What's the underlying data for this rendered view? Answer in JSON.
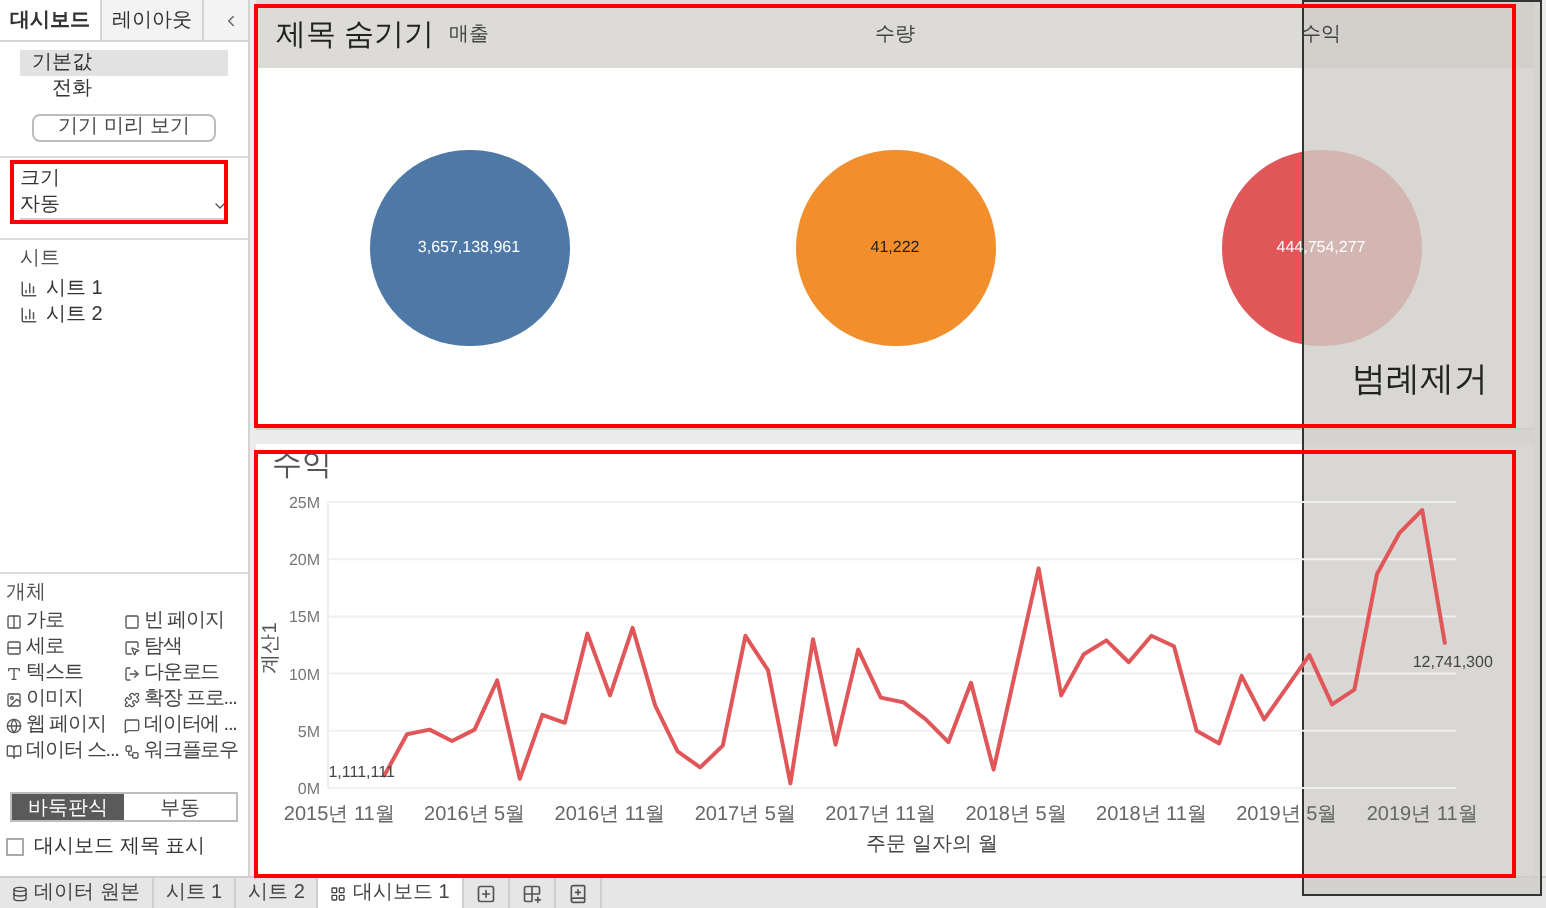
{
  "sidebar": {
    "tabs": [
      {
        "label": "대시보드",
        "selected": true
      },
      {
        "label": "레이아웃",
        "selected": false
      }
    ],
    "devices": [
      {
        "label": "기본값",
        "selected": true
      },
      {
        "label": "전화",
        "selected": false
      }
    ],
    "preview_button": "기기 미리 보기",
    "size": {
      "label": "크기",
      "value": "자동"
    },
    "sheets": {
      "title": "시트",
      "items": [
        "시트 1",
        "시트 2"
      ]
    },
    "objects": {
      "title": "개체",
      "items": [
        {
          "label": "가로",
          "kind": "horizontal"
        },
        {
          "label": "빈 페이지",
          "kind": "blank"
        },
        {
          "label": "세로",
          "kind": "vertical"
        },
        {
          "label": "탐색",
          "kind": "navigation"
        },
        {
          "label": "텍스트",
          "kind": "text"
        },
        {
          "label": "다운로드",
          "kind": "download"
        },
        {
          "label": "이미지",
          "kind": "image"
        },
        {
          "label": "확장 프로...",
          "kind": "extension"
        },
        {
          "label": "웹 페이지",
          "kind": "web"
        },
        {
          "label": "데이터에 ...",
          "kind": "ask"
        },
        {
          "label": "데이터 스...",
          "kind": "story"
        },
        {
          "label": "워크플로우",
          "kind": "workflow"
        }
      ]
    },
    "layout_mode": [
      {
        "label": "바둑판식",
        "selected": true
      },
      {
        "label": "부동",
        "selected": false
      }
    ],
    "show_title": {
      "label": "대시보드 제목 표시",
      "checked": false
    }
  },
  "dashboard": {
    "measures": [
      {
        "header": "매출",
        "value": "3,657,138,961",
        "color": "#4e79a7"
      },
      {
        "header": "수량",
        "value": "41,222",
        "color": "#f28e2b"
      },
      {
        "header": "수익",
        "value": "444,754,277",
        "color": "#e15759"
      }
    ],
    "line_chart": {
      "title": "수익",
      "chart_data": {
        "type": "line",
        "xlabel": "주문 일자의 월",
        "ylabel": "계산1",
        "categories": [
          "2015년 11월",
          null,
          null,
          null,
          null,
          null,
          "2016년 5월",
          null,
          null,
          null,
          null,
          null,
          "2016년 11월",
          null,
          null,
          null,
          null,
          null,
          "2017년 5월",
          null,
          null,
          null,
          null,
          null,
          "2017년 11월",
          null,
          null,
          null,
          null,
          null,
          "2018년 5월",
          null,
          null,
          null,
          null,
          null,
          "2018년 11월",
          null,
          null,
          null,
          null,
          null,
          "2019년 5월",
          null,
          null,
          null,
          null,
          null,
          "2019년 11월",
          null
        ],
        "grid": true,
        "series": [
          {
            "color": "#e15759",
            "values": [
              null,
              null,
              1.1,
              4.7,
              5.1,
              4.1,
              5.1,
              9.4,
              0.8,
              6.4,
              5.7,
              13.5,
              8.1,
              14.0,
              7.2,
              3.2,
              1.8,
              3.7,
              13.3,
              10.3,
              0.4,
              13.0,
              3.8,
              12.1,
              7.9,
              7.5,
              6.0,
              4.0,
              9.2,
              1.6,
              10.4,
              19.2,
              8.1,
              11.7,
              12.9,
              11.0,
              13.3,
              12.4,
              5.0,
              3.9,
              9.8,
              6.0,
              8.8,
              11.6,
              7.3,
              8.6,
              18.7,
              22.3,
              24.3,
              12.7
            ]
          }
        ],
        "ylim": [
          0,
          25
        ],
        "yticks": [
          {
            "value": 0,
            "label": "0M"
          },
          {
            "value": 5,
            "label": "5M"
          },
          {
            "value": 10,
            "label": "10M"
          },
          {
            "value": 15,
            "label": "15M"
          },
          {
            "value": 20,
            "label": "20M"
          },
          {
            "value": 25,
            "label": "25M"
          }
        ],
        "annotations": [
          {
            "text": "1,111,111"
          },
          {
            "text": "12,741,300"
          }
        ]
      }
    }
  },
  "notes": {
    "hide_title": "제목 숨기기",
    "remove_legend": "범례제거"
  },
  "bottom_tabs": [
    {
      "label": "데이터 원본",
      "kind": "source",
      "selected": false
    },
    {
      "label": "시트 1",
      "kind": "sheet",
      "selected": false
    },
    {
      "label": "시트 2",
      "kind": "sheet",
      "selected": false
    },
    {
      "label": "대시보드 1",
      "kind": "dashboard",
      "selected": true
    }
  ]
}
